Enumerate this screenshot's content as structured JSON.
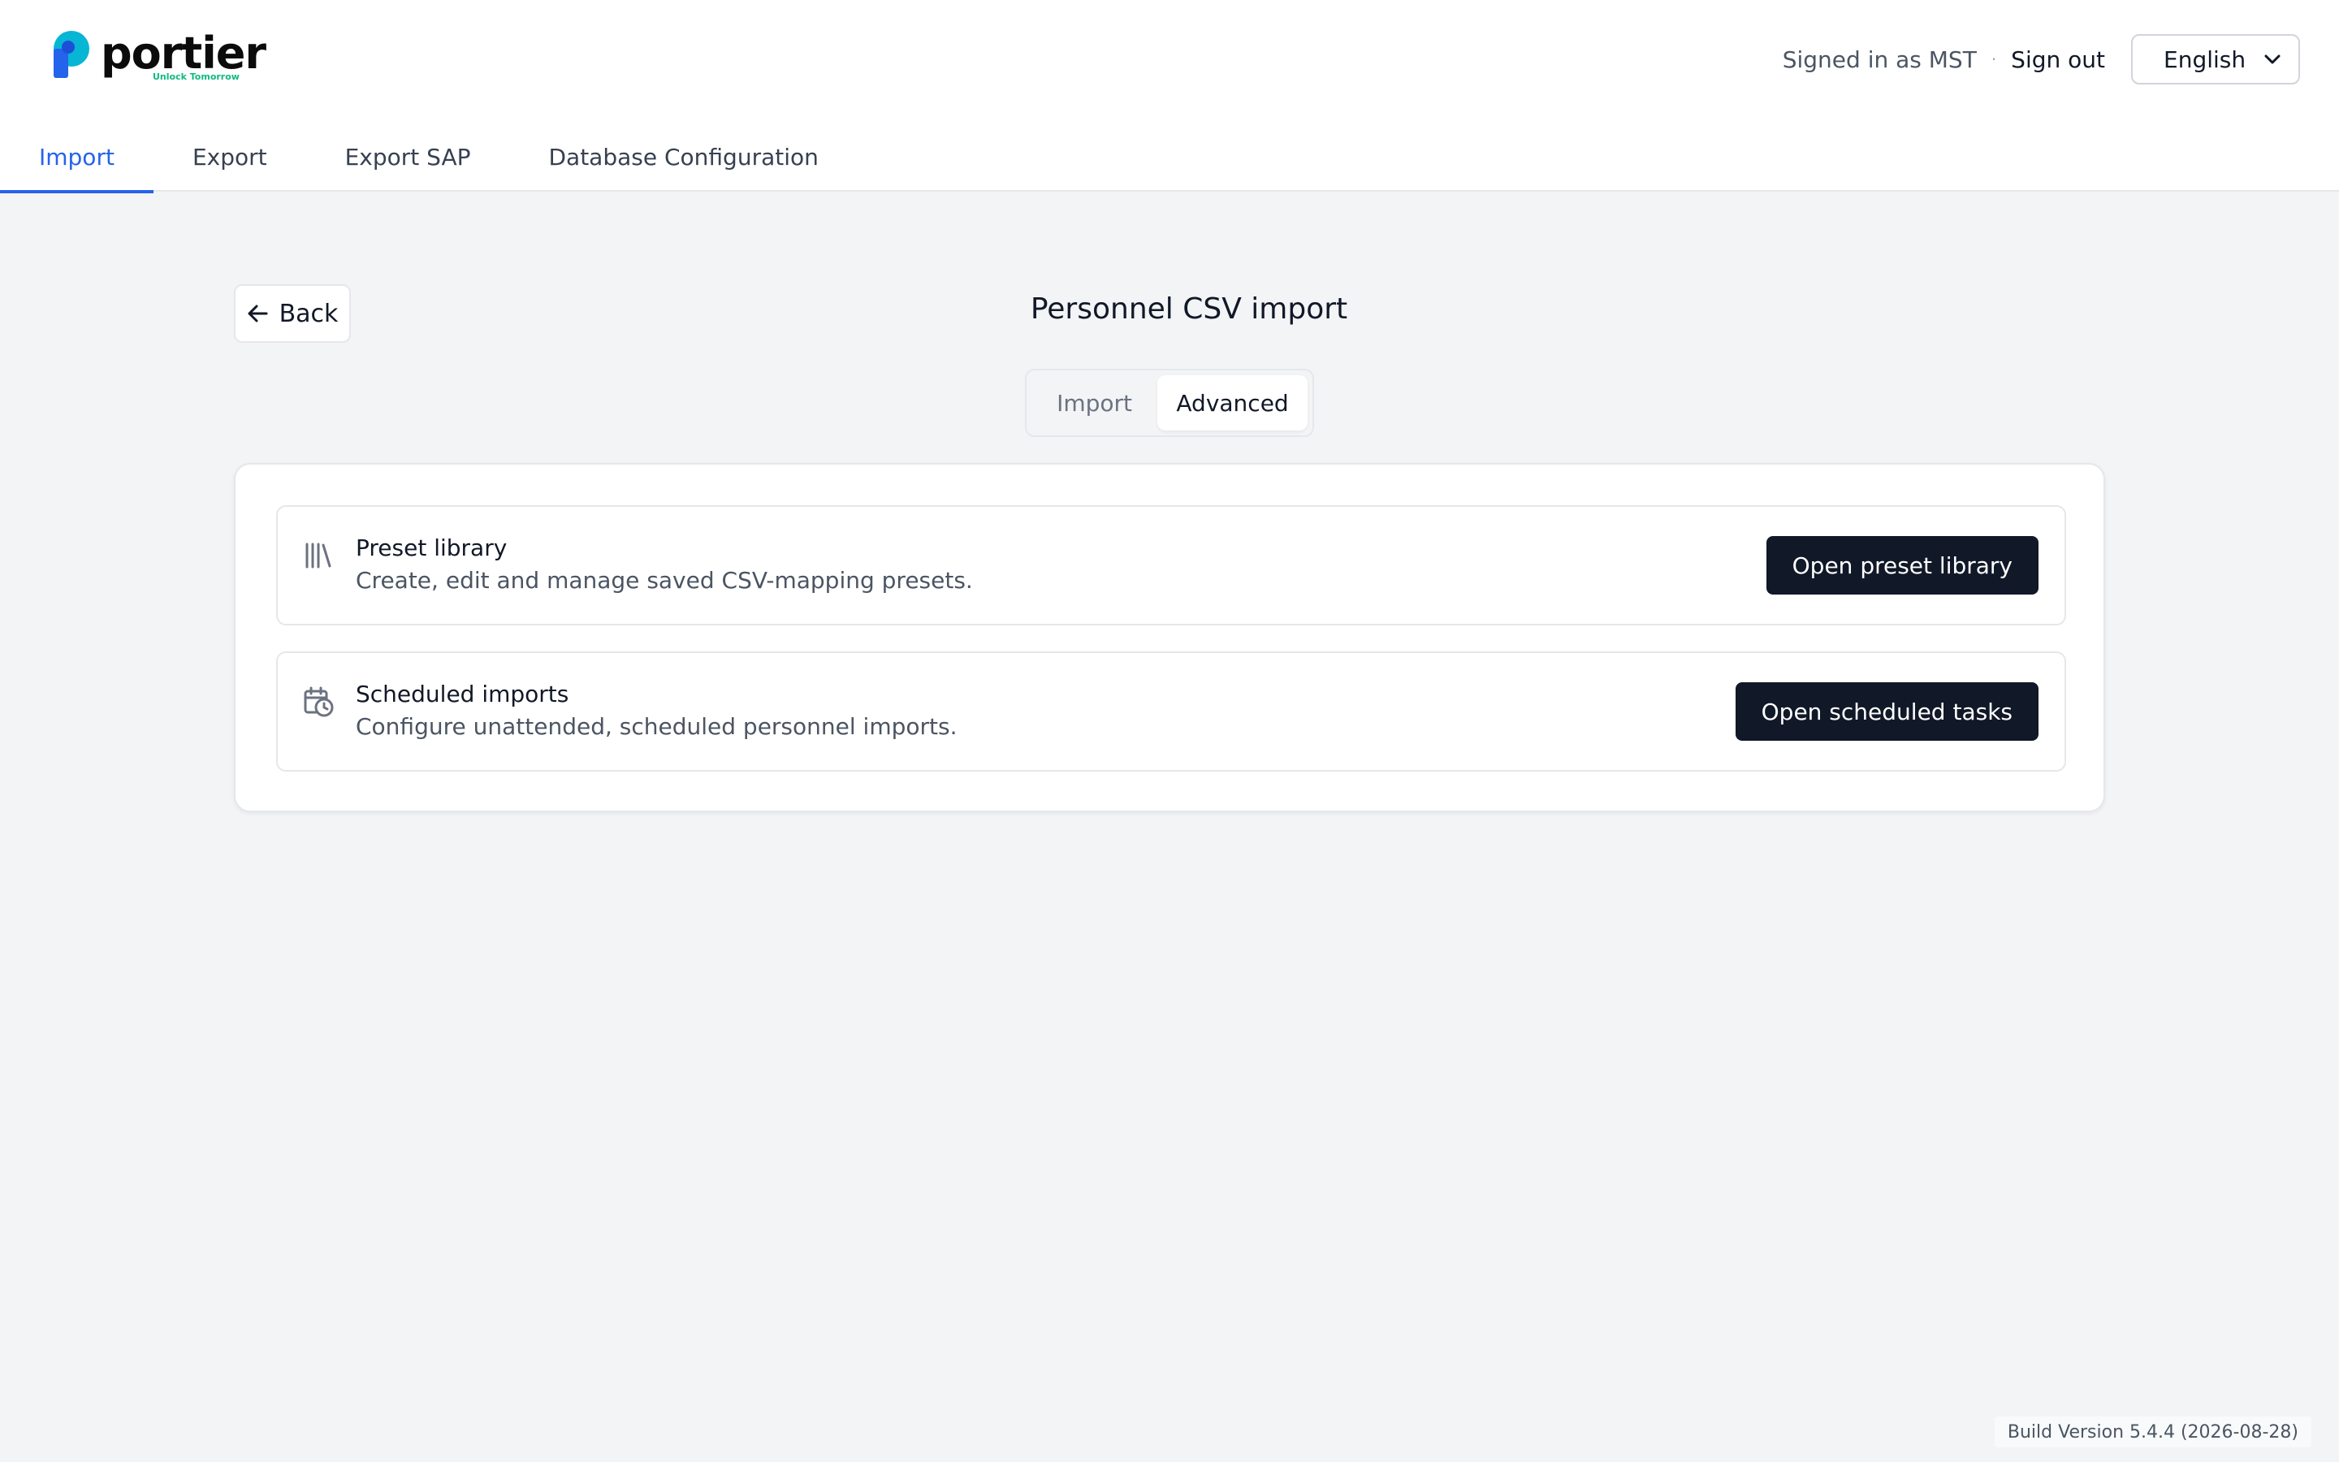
{
  "brand": {
    "name": "portier",
    "tagline": "Unlock Tomorrow",
    "accent": "#10b981",
    "mark_color": "#2563eb"
  },
  "user": {
    "signed_in_text": "Signed in as MST",
    "sign_out_label": "Sign out"
  },
  "language": {
    "selected": "English"
  },
  "nav": {
    "tabs": [
      {
        "label": "Import",
        "active": true
      },
      {
        "label": "Export",
        "active": false
      },
      {
        "label": "Export SAP",
        "active": false
      },
      {
        "label": "Database Configuration",
        "active": false
      }
    ]
  },
  "page": {
    "back_label": "Back",
    "title": "Personnel CSV import",
    "segments": [
      {
        "label": "Import",
        "active": false
      },
      {
        "label": "Advanced",
        "active": true
      }
    ]
  },
  "features": [
    {
      "icon": "library-icon",
      "title": "Preset library",
      "description": "Create, edit and manage saved CSV-mapping presets.",
      "button_label": "Open preset library"
    },
    {
      "icon": "calendar-clock-icon",
      "title": "Scheduled imports",
      "description": "Configure unattended, scheduled personnel imports.",
      "button_label": "Open scheduled tasks"
    }
  ],
  "footer": {
    "build_version": "Build Version 5.4.4 (2026-08-28)"
  },
  "colors": {
    "primary": "#2563eb",
    "dark_button": "#111827",
    "background": "#f3f4f6"
  }
}
